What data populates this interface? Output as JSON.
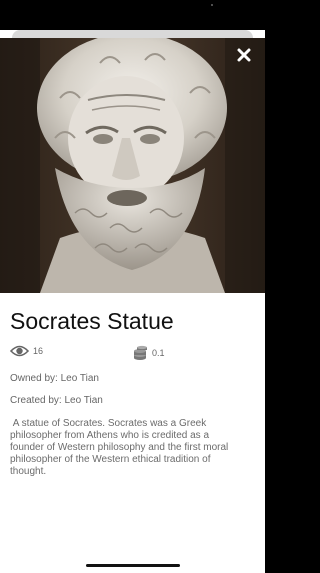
{
  "item": {
    "title": "Socrates Statue",
    "views": "16",
    "price": "0.1",
    "owned_by": "Owned by: Leo Tian",
    "created_by": "Created by: Leo Tian",
    "description": " A statue of Socrates. Socrates was a Greek\nphilosopher from Athens who is credited as a\nfounder of Western philosophy and the first moral\nphilosopher of the Western ethical tradition of\nthought."
  },
  "icons": {
    "close": "close-icon",
    "views": "eye-icon",
    "price": "coins-icon",
    "image": "socrates-statue-image"
  },
  "colors": {
    "background": "#000000",
    "sheet": "#ffffff",
    "title": "#111111",
    "meta_text": "#666666"
  }
}
